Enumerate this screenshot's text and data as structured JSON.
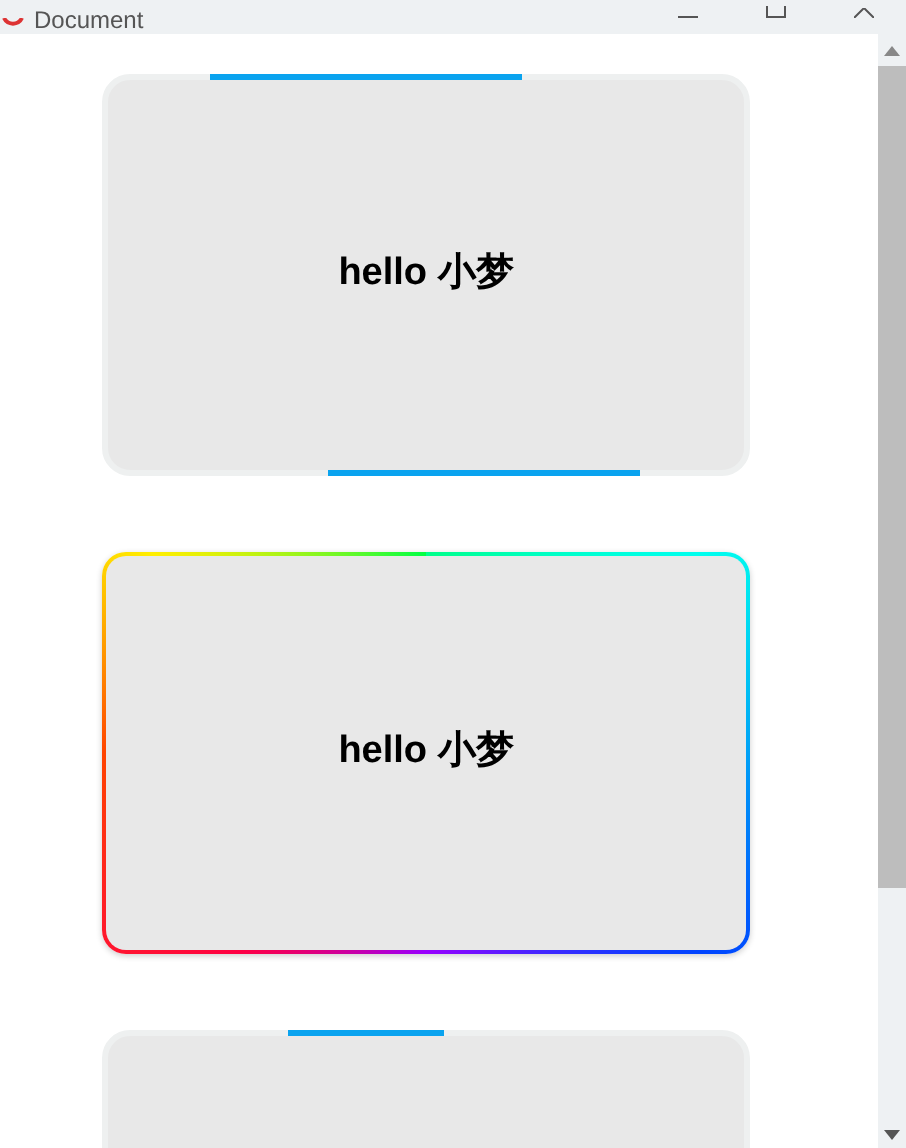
{
  "window": {
    "title": "Document"
  },
  "cards": [
    {
      "kind": "lines",
      "text": "hello 小梦"
    },
    {
      "kind": "rainbow",
      "text": "hello 小梦"
    },
    {
      "kind": "lines-short"
    }
  ]
}
